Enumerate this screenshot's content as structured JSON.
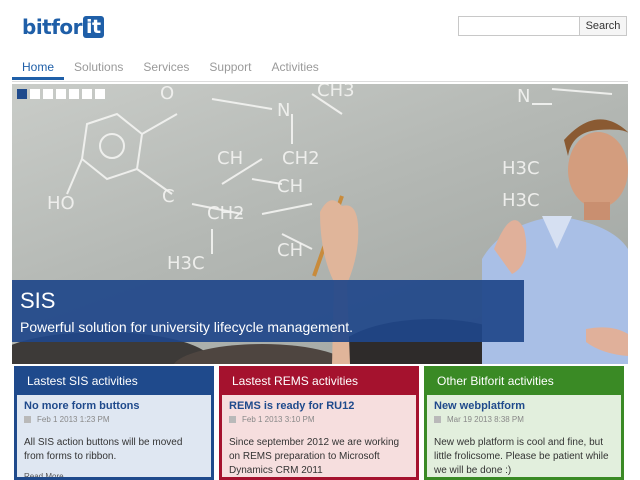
{
  "header": {
    "logo_main": "bitfor",
    "logo_accent": "it",
    "search": {
      "value": "",
      "placeholder": ""
    },
    "search_button": "Search"
  },
  "nav": {
    "items": [
      {
        "label": "Home",
        "active": true
      },
      {
        "label": "Solutions",
        "active": false
      },
      {
        "label": "Services",
        "active": false
      },
      {
        "label": "Support",
        "active": false
      },
      {
        "label": "Activities",
        "active": false
      }
    ]
  },
  "hero": {
    "slide_count": 7,
    "active_slide": 1,
    "title": "SIS",
    "subtitle": "Powerful solution for university lifecycle management."
  },
  "panels": [
    {
      "heading": "Lastest SIS activities",
      "color": "#1f4a8c",
      "item": {
        "title": "No more form buttons",
        "date": "Feb 1 2013 1:23 PM",
        "text": "All SIS action buttons will be moved from forms to ribbon.",
        "more": "Read More..."
      }
    },
    {
      "heading": "Lastest REMS activities",
      "color": "#a5122e",
      "item": {
        "title": "REMS is ready for RU12",
        "date": "Feb 1 2013 3:10 PM",
        "text": "Since september 2012 we are working on REMS preparation to Microsoft Dynamics CRM 2011"
      }
    },
    {
      "heading": "Other Bitforit activities",
      "color": "#3a8a25",
      "item": {
        "title": "New webplatform",
        "date": "Mar 19 2013 8:38 PM",
        "text": "New web platform is cool and fine, but little frolicsome. Please be patient while we will be done :)"
      }
    }
  ]
}
